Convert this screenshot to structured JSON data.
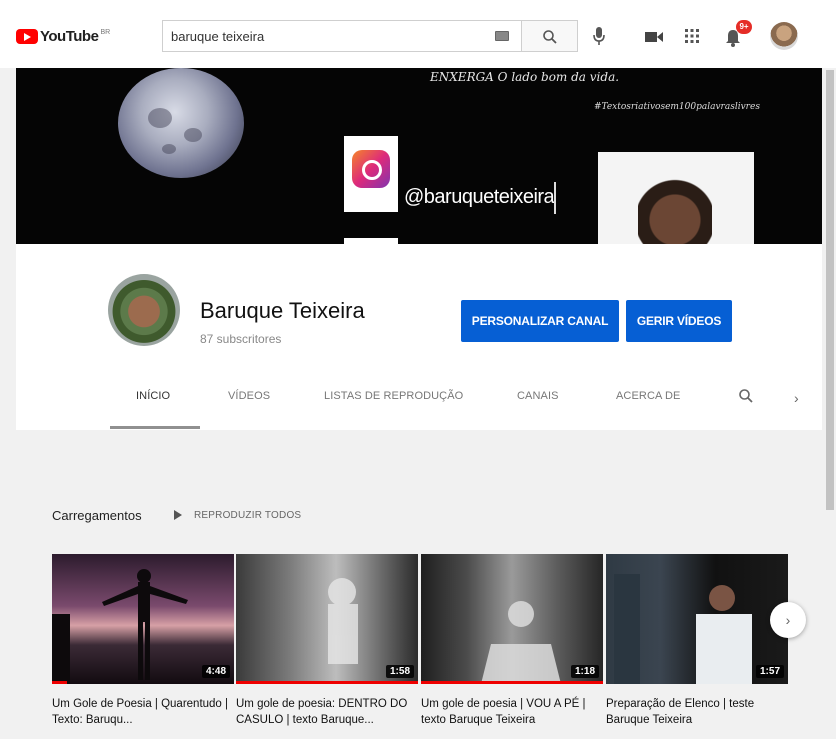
{
  "header": {
    "logo_text": "YouTube",
    "logo_region": "BR",
    "search_value": "baruque teixeira",
    "notification_count": "9+"
  },
  "banner": {
    "quote": "ENXERGA O lado bom da vida.",
    "hashtag": "#Textosriativosem100palavraslivres",
    "handle": "@baruqueteixeira"
  },
  "channel": {
    "name": "Baruque Teixeira",
    "subscribers": "87 subscritores",
    "customize_label": "PERSONALIZAR CANAL",
    "manage_label": "GERIR VÍDEOS"
  },
  "tabs": [
    {
      "label": "INÍCIO"
    },
    {
      "label": "VÍDEOS"
    },
    {
      "label": "LISTAS DE REPRODUÇÃO"
    },
    {
      "label": "CANAIS"
    },
    {
      "label": "ACERCA DE"
    }
  ],
  "uploads": {
    "title": "Carregamentos",
    "play_all": "REPRODUZIR TODOS",
    "videos": [
      {
        "title": "Um Gole de Poesia | Quarentudo | Texto: Baruqu...",
        "duration": "4:48",
        "progress": 0.08
      },
      {
        "title": "Um gole de poesia: DENTRO DO CASULO | texto Baruque...",
        "duration": "1:58",
        "progress": 1.0
      },
      {
        "title": "Um gole de poesia | VOU A PÉ | texto Baruque Teixeira",
        "duration": "1:18",
        "progress": 1.0
      },
      {
        "title": "Preparação de Elenco | teste Baruque Teixeira",
        "duration": "1:57",
        "progress": 0.0
      }
    ]
  }
}
